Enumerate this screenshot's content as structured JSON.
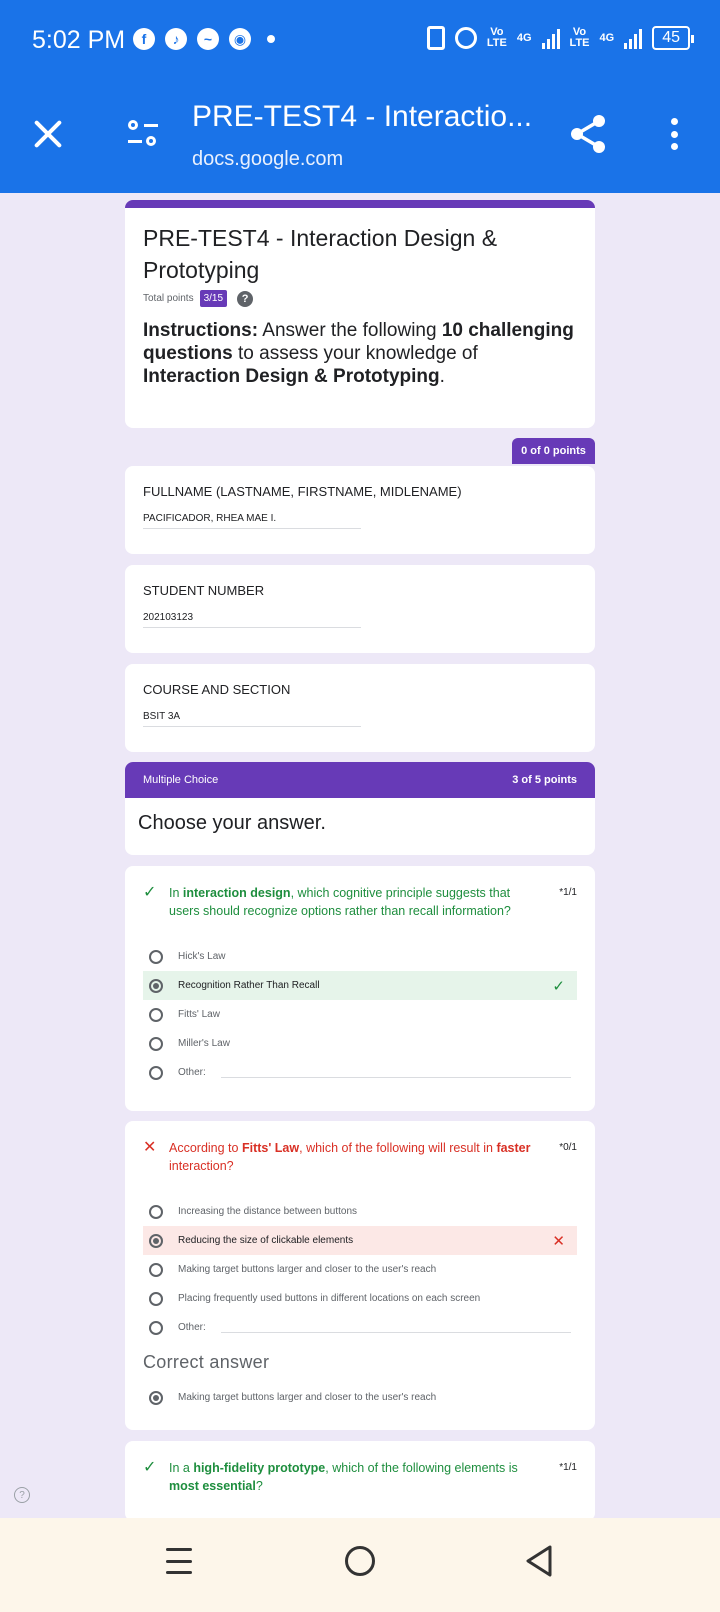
{
  "status_bar": {
    "time": "5:02 PM",
    "app_icons": [
      "facebook-icon",
      "tiktok-icon",
      "messenger-icon",
      "camera-app-icon"
    ],
    "net1": "Vo\nLTE",
    "net1_type": "4G",
    "net2": "Vo\nLTE",
    "net2_type": "4G",
    "battery": "45"
  },
  "browser": {
    "title": "PRE-TEST4 - Interactio...",
    "url": "docs.google.com"
  },
  "form": {
    "title": "PRE-TEST4 - Interaction Design & Prototyping",
    "total_points_label": "Total points",
    "score": "3/15",
    "instructions": {
      "p1": "Instructions:",
      "p2": " Answer the following ",
      "p3": "10 challenging questions",
      "p4": " to assess your knowledge of ",
      "p5": "Interaction Design & Prototyping",
      "p6": "."
    },
    "info_points": "0 of 0 points",
    "fields": [
      {
        "label": "FULLNAME (LASTNAME, FIRSTNAME, MIDLENAME)",
        "value": "PACIFICADOR, RHEA MAE I."
      },
      {
        "label": "STUDENT NUMBER",
        "value": "202103123"
      },
      {
        "label": "COURSE AND SECTION",
        "value": "BSIT 3A"
      }
    ],
    "section": {
      "title": "Multiple Choice",
      "points": "3 of 5 points",
      "description": "Choose your answer."
    },
    "questions": [
      {
        "status": "correct",
        "t1": "In ",
        "t2": "interaction design",
        "t3": ", which cognitive principle suggests that users should recognize options rather than recall information?",
        "points": "*1/1",
        "options": [
          "Hick's Law",
          "Recognition Rather Than Recall",
          "Fitts' Law",
          "Miller's Law",
          "Other:"
        ],
        "selected": 1
      },
      {
        "status": "incorrect",
        "t1": "According to ",
        "t2": "Fitts' Law",
        "t3": ", which of the following will result in ",
        "t4": "faster",
        "t5": " interaction?",
        "points": "*0/1",
        "options": [
          "Increasing the distance between buttons",
          "Reducing the size of clickable elements",
          "Making target buttons larger and closer to the user's reach",
          "Placing frequently used buttons in different locations on each screen",
          "Other:"
        ],
        "selected": 1,
        "correct_label": "Correct answer",
        "correct_answer": "Making target buttons larger and closer to the user's reach"
      },
      {
        "status": "correct",
        "t1": "In a ",
        "t2": "high-fidelity prototype",
        "t3": ", which of the following elements is ",
        "t4": "most essential",
        "t5": "?",
        "points": "*1/1"
      }
    ]
  },
  "colors": {
    "header_blue": "#1a73e8",
    "form_purple": "#673ab7",
    "correct_green": "#1e8e3e",
    "incorrect_red": "#d93025",
    "background": "#ede8f7"
  }
}
